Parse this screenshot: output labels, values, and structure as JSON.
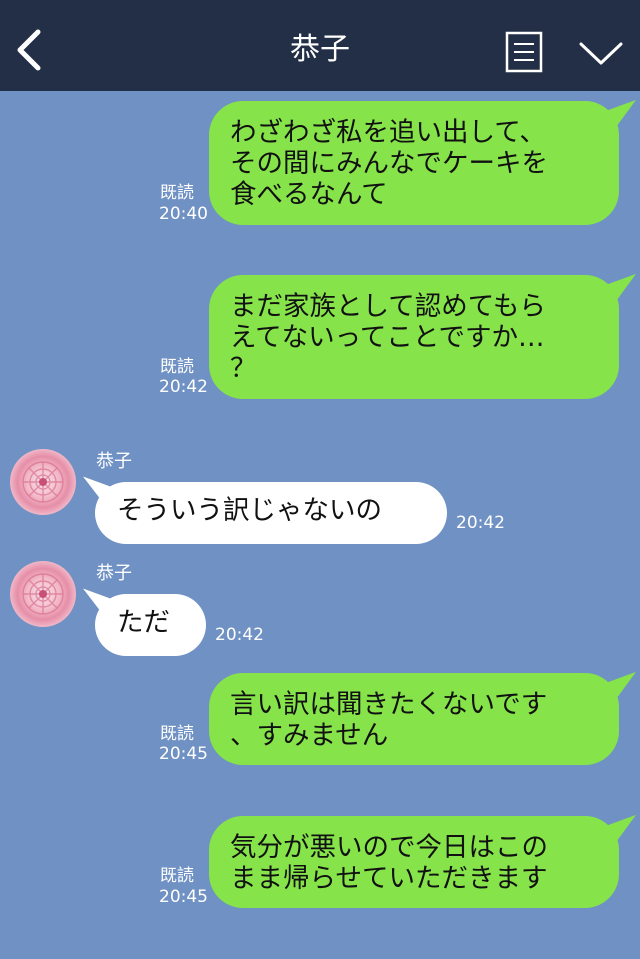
{
  "header": {
    "title": "恭子"
  },
  "messages": [
    {
      "side": "me",
      "text": "わざわざ私を追い出して、\nその間にみんなでケーキを\n食べるなんて",
      "read": "既読",
      "time": "20:40"
    },
    {
      "side": "me",
      "text": "まだ家族として認めてもら\nえてないってことですか…\n？",
      "read": "既読",
      "time": "20:42"
    },
    {
      "side": "other",
      "sender": "恭子",
      "text": "そういう訳じゃないの",
      "time": "20:42"
    },
    {
      "side": "other",
      "sender": "恭子",
      "text": "ただ",
      "time": "20:42"
    },
    {
      "side": "me",
      "text": "言い訳は聞きたくないです\n、すみません",
      "read": "既読",
      "time": "20:45"
    },
    {
      "side": "me",
      "text": "気分が悪いので今日はこの\nまま帰らせていただきます",
      "read": "既読",
      "time": "20:45"
    }
  ]
}
